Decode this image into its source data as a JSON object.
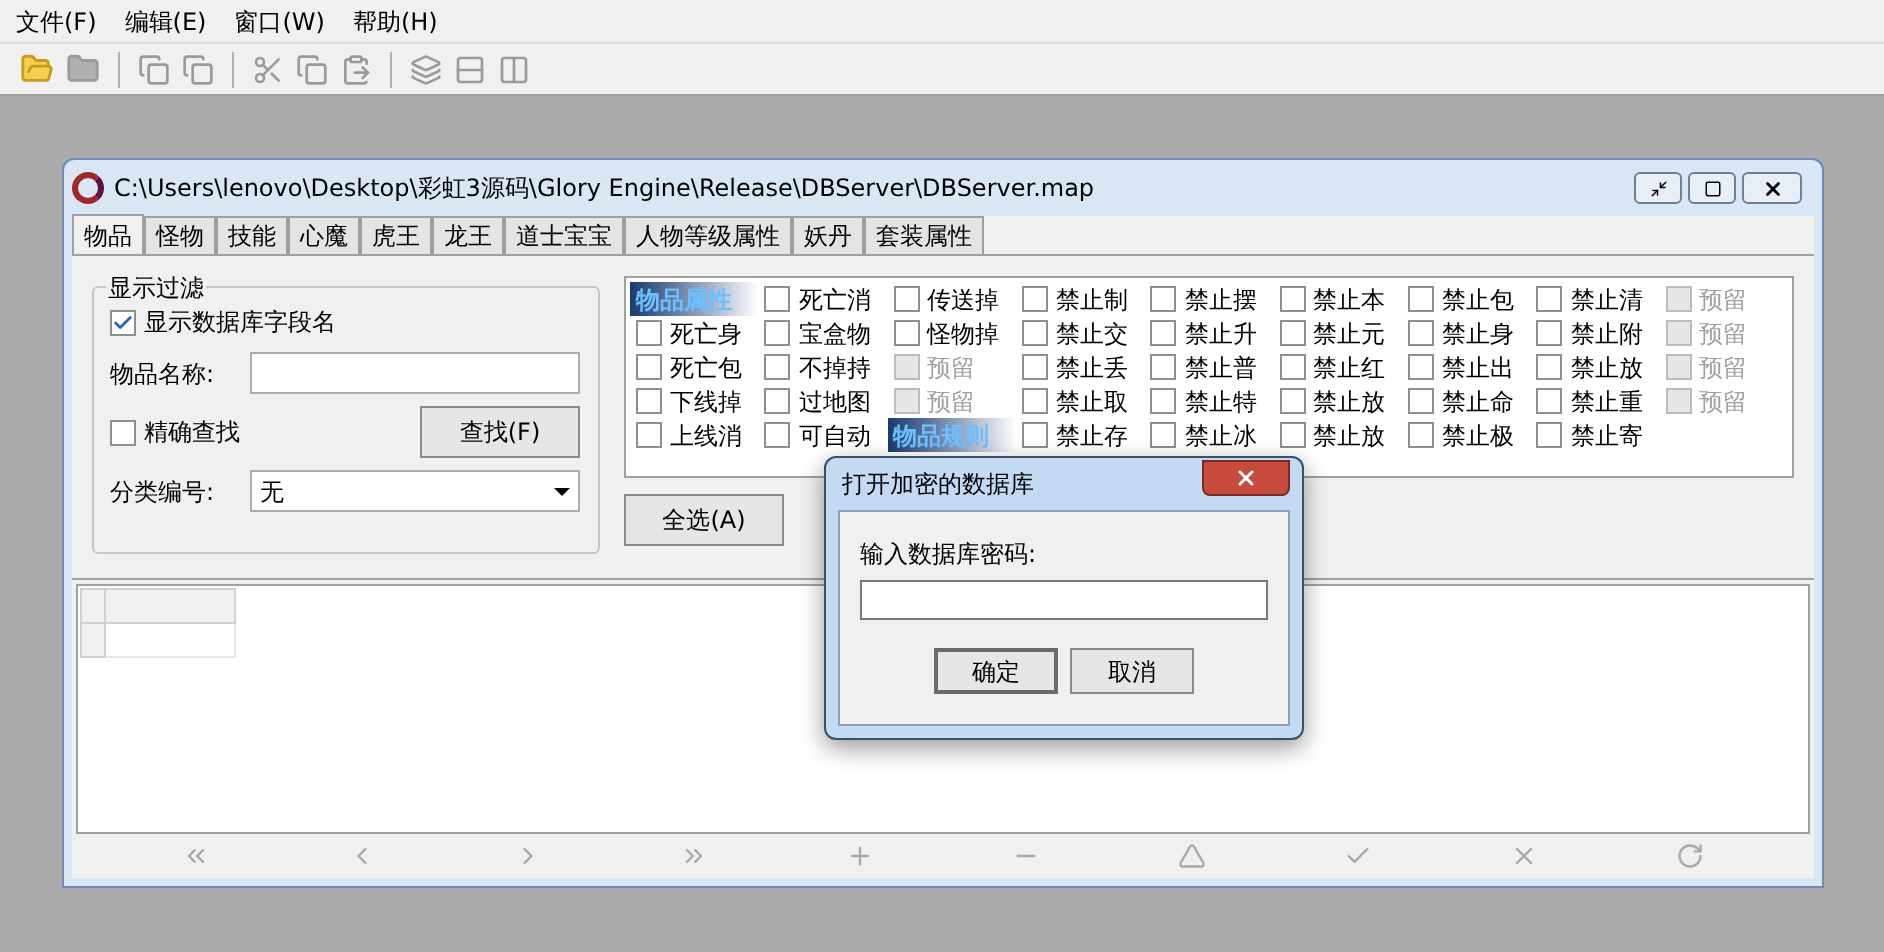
{
  "menu": [
    {
      "label": "文件(F)"
    },
    {
      "label": "编辑(E)"
    },
    {
      "label": "窗口(W)"
    },
    {
      "label": "帮助(H)"
    }
  ],
  "window": {
    "title": "C:\\Users\\lenovo\\Desktop\\彩虹3源码\\Glory Engine\\Release\\DBServer\\DBServer.map"
  },
  "tabs": [
    {
      "label": "物品",
      "selected": true
    },
    {
      "label": "怪物",
      "selected": false
    },
    {
      "label": "技能",
      "selected": false
    },
    {
      "label": "心魔",
      "selected": false
    },
    {
      "label": "虎王",
      "selected": false
    },
    {
      "label": "龙王",
      "selected": false
    },
    {
      "label": "道士宝宝",
      "selected": false
    },
    {
      "label": "人物等级属性",
      "selected": false
    },
    {
      "label": "妖丹",
      "selected": false
    },
    {
      "label": "套装属性",
      "selected": false
    }
  ],
  "filter": {
    "title": "显示过滤",
    "show_field_names": {
      "label": "显示数据库字段名",
      "checked": true
    },
    "name_label": "物品名称:",
    "exact": {
      "label": "精确查找",
      "checked": false
    },
    "find_button": "查找(F)",
    "category_label": "分类编号:",
    "category_value": "无"
  },
  "attribute_grid": [
    [
      {
        "kind": "header",
        "text": "物品属性"
      },
      {
        "kind": "checkbox",
        "label": "死亡消",
        "checked": false,
        "disabled": false
      },
      {
        "kind": "checkbox",
        "label": "传送掉",
        "checked": false,
        "disabled": false
      },
      {
        "kind": "checkbox",
        "label": "禁止制",
        "checked": false,
        "disabled": false
      },
      {
        "kind": "checkbox",
        "label": "禁止摆",
        "checked": false,
        "disabled": false
      },
      {
        "kind": "checkbox",
        "label": "禁止本",
        "checked": false,
        "disabled": false
      },
      {
        "kind": "checkbox",
        "label": "禁止包",
        "checked": false,
        "disabled": false
      },
      {
        "kind": "checkbox",
        "label": "禁止清",
        "checked": false,
        "disabled": false
      },
      {
        "kind": "checkbox",
        "label": "预留",
        "checked": false,
        "disabled": true
      }
    ],
    [
      {
        "kind": "checkbox",
        "label": "死亡身",
        "checked": false,
        "disabled": false
      },
      {
        "kind": "checkbox",
        "label": "宝盒物",
        "checked": false,
        "disabled": false
      },
      {
        "kind": "checkbox",
        "label": "怪物掉",
        "checked": false,
        "disabled": false
      },
      {
        "kind": "checkbox",
        "label": "禁止交",
        "checked": false,
        "disabled": false
      },
      {
        "kind": "checkbox",
        "label": "禁止升",
        "checked": false,
        "disabled": false
      },
      {
        "kind": "checkbox",
        "label": "禁止元",
        "checked": false,
        "disabled": false
      },
      {
        "kind": "checkbox",
        "label": "禁止身",
        "checked": false,
        "disabled": false
      },
      {
        "kind": "checkbox",
        "label": "禁止附",
        "checked": false,
        "disabled": false
      },
      {
        "kind": "checkbox",
        "label": "预留",
        "checked": false,
        "disabled": true
      }
    ],
    [
      {
        "kind": "checkbox",
        "label": "死亡包",
        "checked": false,
        "disabled": false
      },
      {
        "kind": "checkbox",
        "label": "不掉持",
        "checked": false,
        "disabled": false
      },
      {
        "kind": "checkbox",
        "label": "预留",
        "checked": false,
        "disabled": true
      },
      {
        "kind": "checkbox",
        "label": "禁止丢",
        "checked": false,
        "disabled": false
      },
      {
        "kind": "checkbox",
        "label": "禁止普",
        "checked": false,
        "disabled": false
      },
      {
        "kind": "checkbox",
        "label": "禁止红",
        "checked": false,
        "disabled": false
      },
      {
        "kind": "checkbox",
        "label": "禁止出",
        "checked": false,
        "disabled": false
      },
      {
        "kind": "checkbox",
        "label": "禁止放",
        "checked": false,
        "disabled": false
      },
      {
        "kind": "checkbox",
        "label": "预留",
        "checked": false,
        "disabled": true
      }
    ],
    [
      {
        "kind": "checkbox",
        "label": "下线掉",
        "checked": false,
        "disabled": false
      },
      {
        "kind": "checkbox",
        "label": "过地图",
        "checked": false,
        "disabled": false
      },
      {
        "kind": "checkbox",
        "label": "预留",
        "checked": false,
        "disabled": true
      },
      {
        "kind": "checkbox",
        "label": "禁止取",
        "checked": false,
        "disabled": false
      },
      {
        "kind": "checkbox",
        "label": "禁止特",
        "checked": false,
        "disabled": false
      },
      {
        "kind": "checkbox",
        "label": "禁止放",
        "checked": false,
        "disabled": false
      },
      {
        "kind": "checkbox",
        "label": "禁止命",
        "checked": false,
        "disabled": false
      },
      {
        "kind": "checkbox",
        "label": "禁止重",
        "checked": false,
        "disabled": false
      },
      {
        "kind": "checkbox",
        "label": "预留",
        "checked": false,
        "disabled": true
      }
    ],
    [
      {
        "kind": "checkbox",
        "label": "上线消",
        "checked": false,
        "disabled": false
      },
      {
        "kind": "checkbox",
        "label": "可自动",
        "checked": false,
        "disabled": false
      },
      {
        "kind": "header",
        "text": "物品规则"
      },
      {
        "kind": "checkbox",
        "label": "禁止存",
        "checked": false,
        "disabled": false
      },
      {
        "kind": "checkbox",
        "label": "禁止冰",
        "checked": false,
        "disabled": false
      },
      {
        "kind": "checkbox",
        "label": "禁止放",
        "checked": false,
        "disabled": false
      },
      {
        "kind": "checkbox",
        "label": "禁止极",
        "checked": false,
        "disabled": false
      },
      {
        "kind": "checkbox",
        "label": "禁止寄",
        "checked": false,
        "disabled": false
      }
    ]
  ],
  "select_all_button": "全选(A)",
  "dialog": {
    "title": "打开加密的数据库",
    "prompt": "输入数据库密码:",
    "ok_button": "确定",
    "cancel_button": "取消"
  }
}
